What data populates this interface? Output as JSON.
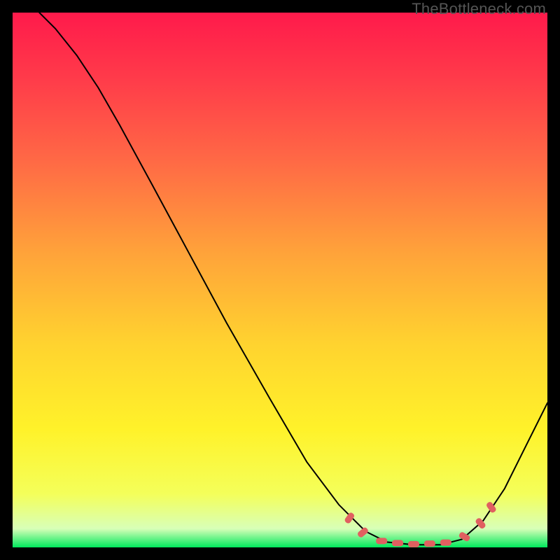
{
  "watermark": "TheBottleneck.com",
  "chart_data": {
    "type": "line",
    "title": "",
    "xlabel": "",
    "ylabel": "",
    "xlim": [
      0,
      100
    ],
    "ylim": [
      0,
      100
    ],
    "gradient_stops": [
      {
        "offset": 0,
        "color": "#ff1a4b"
      },
      {
        "offset": 0.12,
        "color": "#ff3a4a"
      },
      {
        "offset": 0.28,
        "color": "#ff6a45"
      },
      {
        "offset": 0.45,
        "color": "#ffa33a"
      },
      {
        "offset": 0.62,
        "color": "#ffd32f"
      },
      {
        "offset": 0.78,
        "color": "#fff22a"
      },
      {
        "offset": 0.9,
        "color": "#f4ff5a"
      },
      {
        "offset": 0.965,
        "color": "#d8ffb8"
      },
      {
        "offset": 1.0,
        "color": "#00e85c"
      }
    ],
    "series": [
      {
        "name": "bottleneck-curve",
        "color": "#000000",
        "stroke_width": 2,
        "points": [
          {
            "x": 5,
            "y": 100
          },
          {
            "x": 8,
            "y": 97
          },
          {
            "x": 12,
            "y": 92
          },
          {
            "x": 16,
            "y": 86
          },
          {
            "x": 20,
            "y": 79
          },
          {
            "x": 26,
            "y": 68
          },
          {
            "x": 33,
            "y": 55
          },
          {
            "x": 40,
            "y": 42
          },
          {
            "x": 48,
            "y": 28
          },
          {
            "x": 55,
            "y": 16
          },
          {
            "x": 61,
            "y": 8
          },
          {
            "x": 66,
            "y": 3
          },
          {
            "x": 70,
            "y": 1
          },
          {
            "x": 75,
            "y": 0.5
          },
          {
            "x": 80,
            "y": 0.5
          },
          {
            "x": 84,
            "y": 1.5
          },
          {
            "x": 88,
            "y": 5
          },
          {
            "x": 92,
            "y": 11
          },
          {
            "x": 96,
            "y": 19
          },
          {
            "x": 100,
            "y": 27
          }
        ]
      }
    ],
    "markers": {
      "name": "valley-markers",
      "color": "#e06060",
      "shape": "rounded-rect",
      "points": [
        {
          "x": 63,
          "y": 5.5,
          "rot": -55
        },
        {
          "x": 65.5,
          "y": 2.8,
          "rot": -40
        },
        {
          "x": 69,
          "y": 1.2,
          "rot": 0
        },
        {
          "x": 72,
          "y": 0.8,
          "rot": 0
        },
        {
          "x": 75,
          "y": 0.6,
          "rot": 0
        },
        {
          "x": 78,
          "y": 0.7,
          "rot": 0
        },
        {
          "x": 81,
          "y": 0.9,
          "rot": 0
        },
        {
          "x": 84.5,
          "y": 2.0,
          "rot": 30
        },
        {
          "x": 87.5,
          "y": 4.5,
          "rot": 50
        },
        {
          "x": 89.5,
          "y": 7.5,
          "rot": 55
        }
      ]
    }
  }
}
